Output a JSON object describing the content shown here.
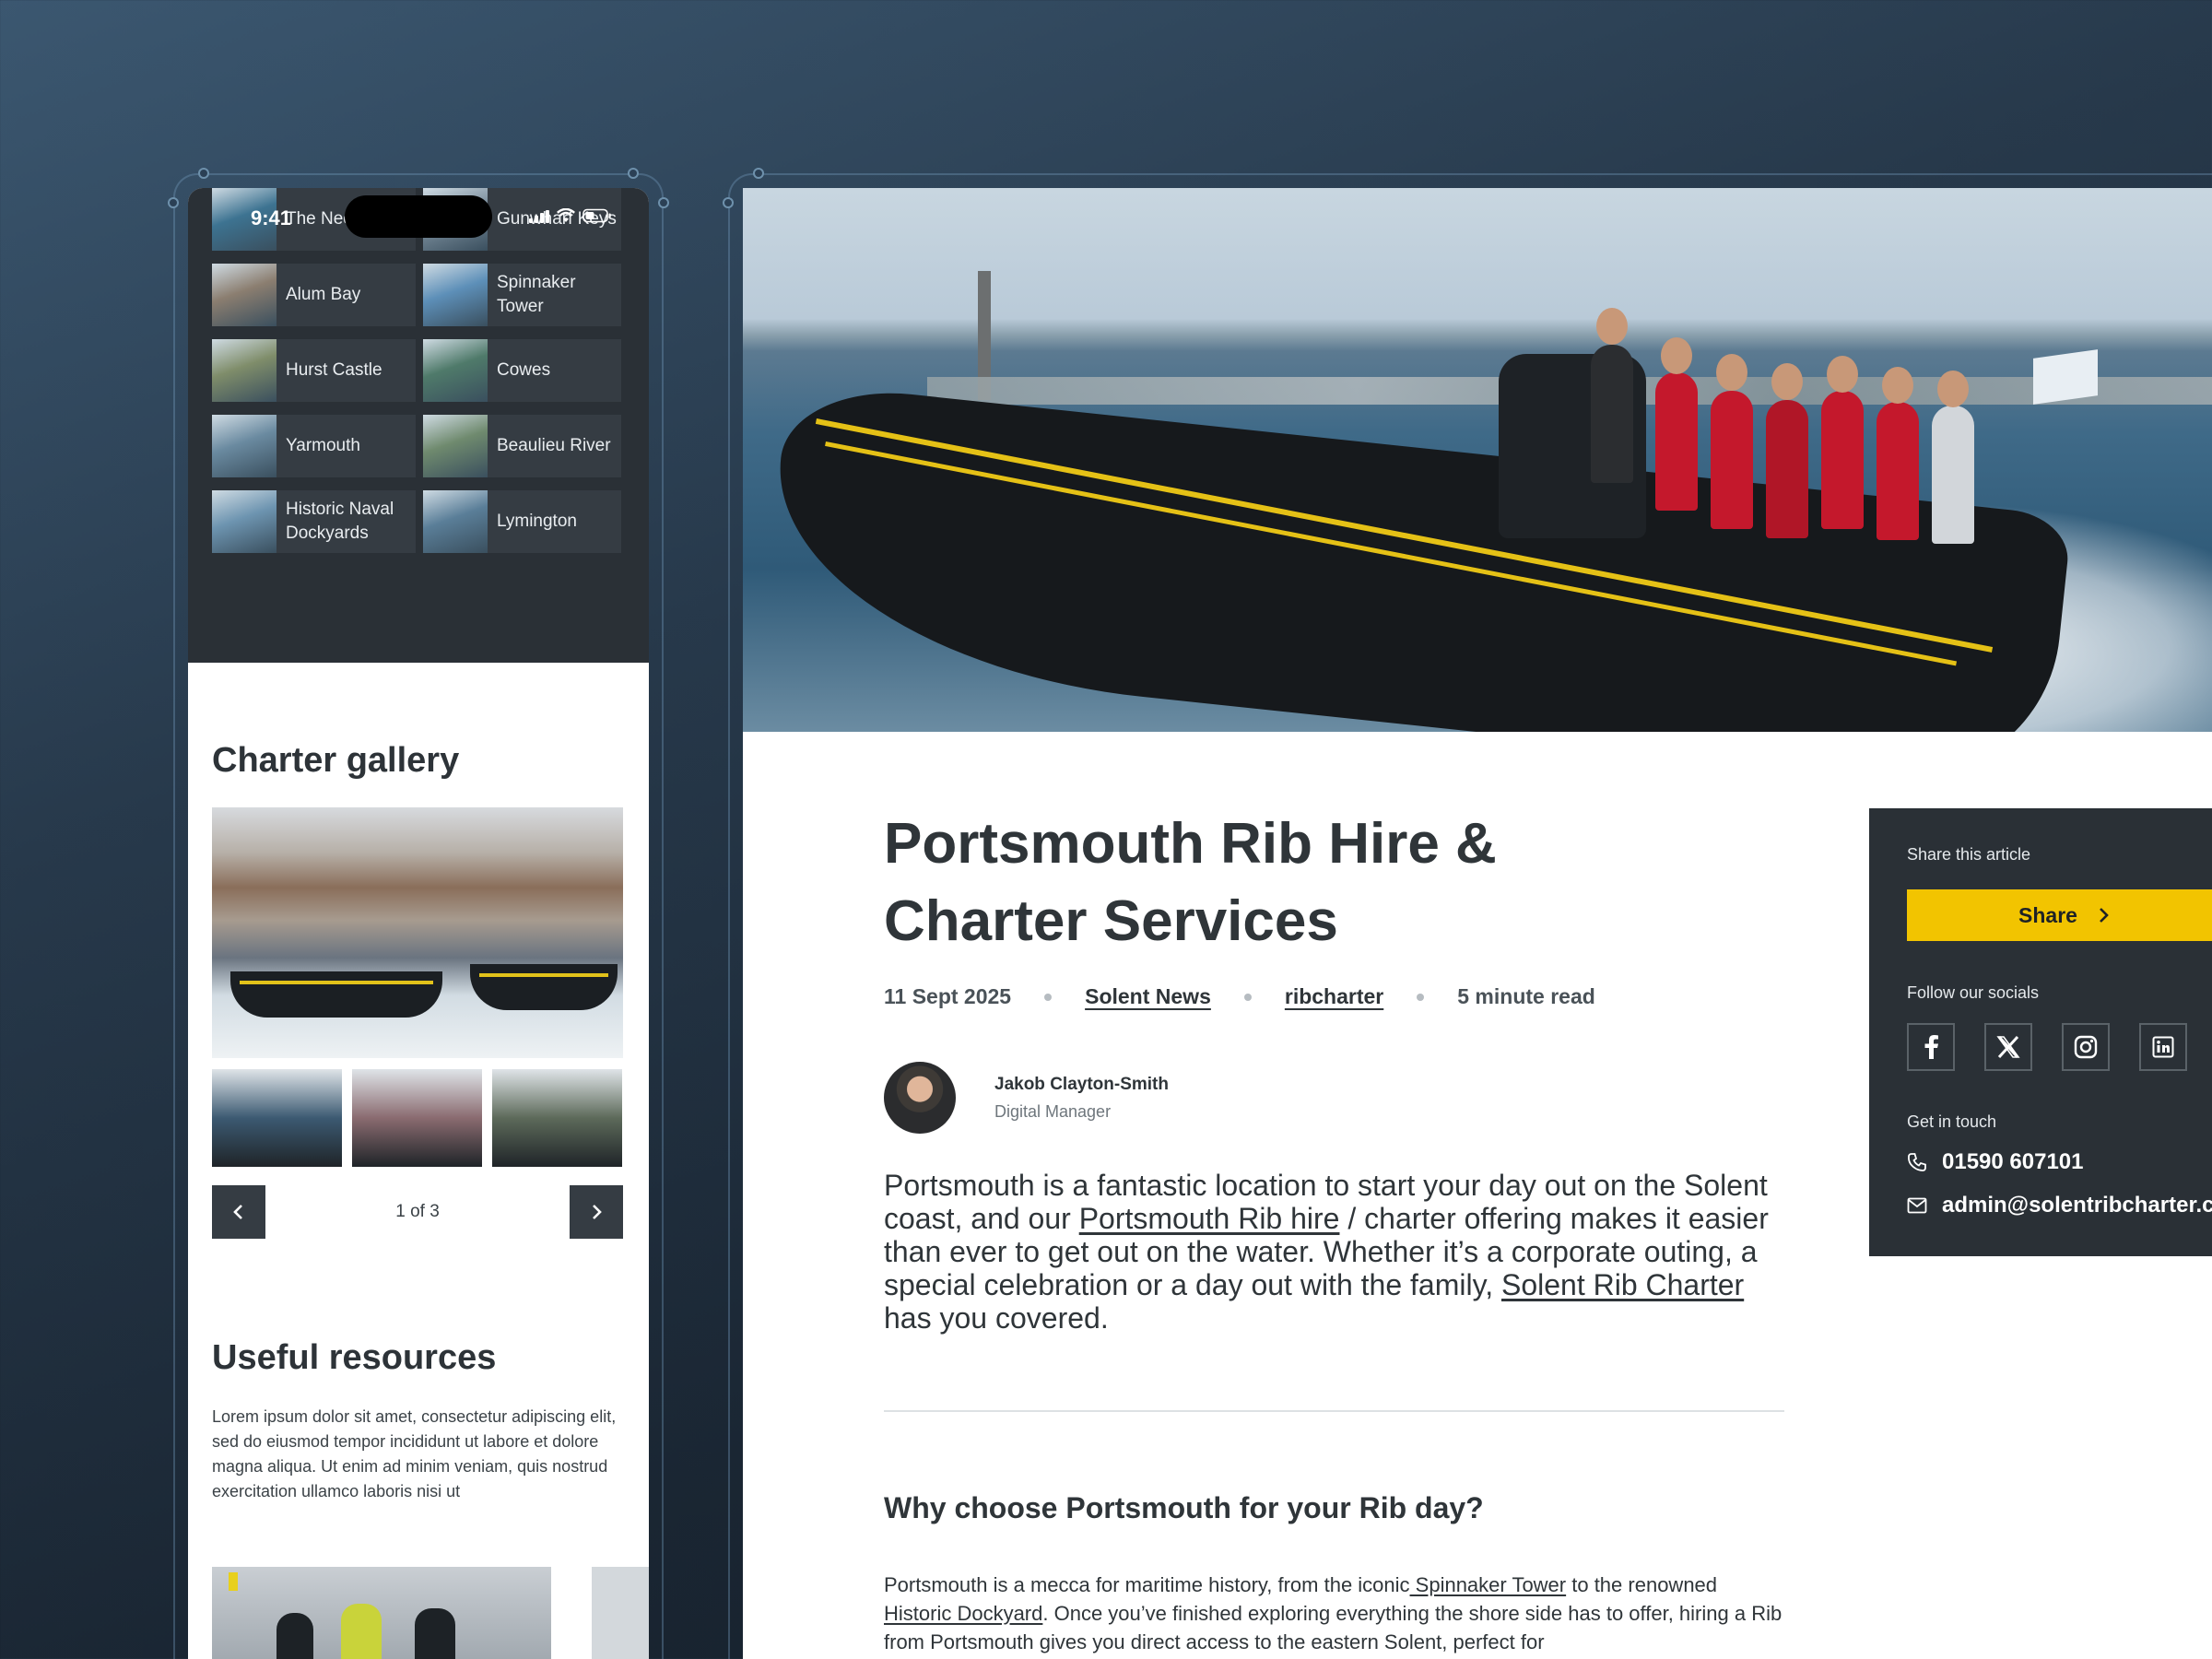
{
  "phone": {
    "status_time": "9:41",
    "locations": [
      {
        "label": "The Needles",
        "color": "#3d7391"
      },
      {
        "label": "Gunwharf Keys",
        "color": "#7b8e9d"
      },
      {
        "label": "Alum Bay",
        "color": "#8b7e70"
      },
      {
        "label": "Spinnaker Tower",
        "color": "#5d8fb8"
      },
      {
        "label": "Hurst Castle",
        "color": "#7f8d6a"
      },
      {
        "label": "Cowes",
        "color": "#4f7a6a"
      },
      {
        "label": "Yarmouth",
        "color": "#6a8aa0"
      },
      {
        "label": "Beaulieu River",
        "color": "#6f8a6e"
      },
      {
        "label": "Historic Naval Dockyards",
        "color": "#6d94b0"
      },
      {
        "label": "Lymington",
        "color": "#5a7e98"
      }
    ],
    "gallery": {
      "title": "Charter gallery",
      "counter": "1 of 3",
      "thumbs": [
        "#3c5a72",
        "#8a6b70",
        "#5d6a5a"
      ]
    },
    "resources": {
      "title": "Useful resources",
      "text": "Lorem ipsum dolor sit amet, consectetur adipiscing elit, sed do eiusmod tempor incididunt ut labore et dolore magna aliqua. Ut enim ad minim veniam, quis nostrud exercitation ullamco laboris nisi ut"
    }
  },
  "article": {
    "title": "Portsmouth Rib Hire & Charter Services",
    "date": "11 Sept 2025",
    "category": "Solent News",
    "author_tag": "ribcharter",
    "read_time": "5 minute read",
    "author_name": "Jakob Clayton-Smith",
    "author_role": "Digital Manager",
    "lead": {
      "p1": "Portsmouth is a fantastic location to start your day out on the Solent coast, and our ",
      "link1": "Portsmouth Rib hire",
      "p2": " / charter offering makes it easier than ever to get out on the water. Whether it’s a corporate outing, a special celebration or a day out with the family, ",
      "link2": "Solent Rib Charter",
      "p3": " has you covered."
    },
    "h2": "Why choose Portsmouth for your Rib day?",
    "body": {
      "p1": "Portsmouth is a mecca for maritime history, from the iconic",
      "link1": " Spinnaker Tower",
      "p2": " to the renowned ",
      "link2": "Historic Dockyard",
      "p3": ". Once you’ve finished exploring everything the shore side has to offer, hiring a Rib from Portsmouth gives you direct access to the eastern Solent, perfect for"
    }
  },
  "sidebar": {
    "share_label": "Share this article",
    "share_button": "Share",
    "follow_label": "Follow our socials",
    "socials": [
      "facebook-icon",
      "x-icon",
      "instagram-icon",
      "linkedin-icon"
    ],
    "contact_label": "Get in touch",
    "phone": "01590 607101",
    "email": "admin@solentribcharter.co.uk",
    "accent": "#f2c400"
  }
}
